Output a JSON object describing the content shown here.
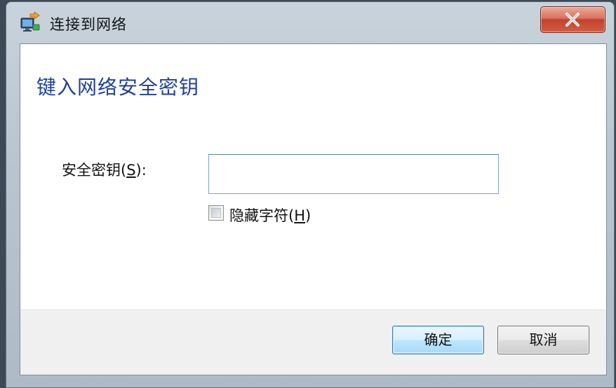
{
  "window": {
    "title": "连接到网络",
    "icon": "network-connect-icon",
    "close_icon": "close-icon"
  },
  "content": {
    "heading": "键入网络安全密钥",
    "key_label_text": "安全密钥(",
    "key_label_accel": "S",
    "key_label_end": "):",
    "key_value": "",
    "hide_chars_text": "隐藏字符(",
    "hide_chars_accel": "H",
    "hide_chars_end": ")",
    "hide_chars_checked": false
  },
  "footer": {
    "ok_label": "确定",
    "cancel_label": "取消"
  },
  "colors": {
    "heading": "#1f3f9a",
    "close_button": "#c3412c",
    "default_button_border": "#3c7fb1"
  }
}
